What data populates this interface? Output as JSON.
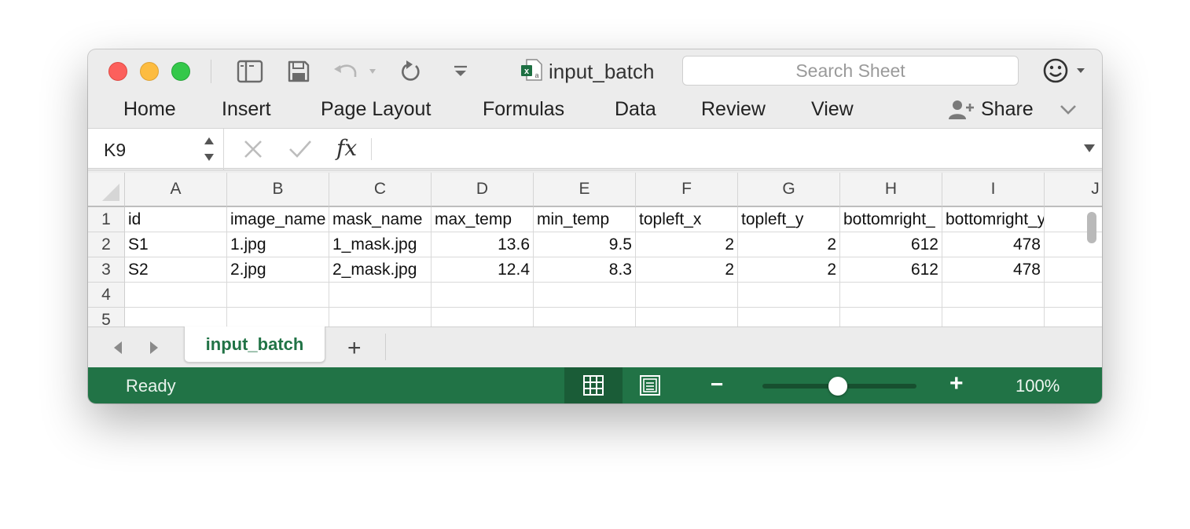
{
  "window": {
    "document_name": "input_batch",
    "search": {
      "placeholder": "Search Sheet"
    }
  },
  "ribbon": {
    "tabs": [
      "Home",
      "Insert",
      "Page Layout",
      "Formulas",
      "Data",
      "Review",
      "View"
    ],
    "share_label": "Share"
  },
  "formula_bar": {
    "name_box": "K9",
    "fx_label": "fx",
    "formula": ""
  },
  "grid": {
    "columns": [
      "A",
      "B",
      "C",
      "D",
      "E",
      "F",
      "G",
      "H",
      "I",
      "J"
    ],
    "row_numbers": [
      "1",
      "2",
      "3",
      "4",
      "5"
    ],
    "rows": [
      [
        "id",
        "image_name",
        "mask_name",
        "max_temp",
        "min_temp",
        "topleft_x",
        "topleft_y",
        "bottomright_",
        "bottomright_y",
        ""
      ],
      [
        "S1",
        "1.jpg",
        "1_mask.jpg",
        "13.6",
        "9.5",
        "2",
        "2",
        "612",
        "478",
        ""
      ],
      [
        "S2",
        "2.jpg",
        "2_mask.jpg",
        "12.4",
        "8.3",
        "2",
        "2",
        "612",
        "478",
        ""
      ],
      [
        "",
        "",
        "",
        "",
        "",
        "",
        "",
        "",
        "",
        ""
      ],
      [
        "",
        "",
        "",
        "",
        "",
        "",
        "",
        "",
        "",
        ""
      ]
    ],
    "numeric_columns": [
      3,
      4,
      5,
      6,
      7,
      8
    ]
  },
  "sheets": {
    "tabs": [
      "input_batch"
    ],
    "active": "input_batch",
    "add_label": "+"
  },
  "status_bar": {
    "status": "Ready",
    "zoom_out_label": "−",
    "zoom_in_label": "+",
    "zoom": "100%",
    "zoom_level": 100
  },
  "colors": {
    "accent_green": "#217346",
    "close": "#fc605c",
    "minimize": "#fdbc40",
    "maximize": "#34c84a"
  }
}
